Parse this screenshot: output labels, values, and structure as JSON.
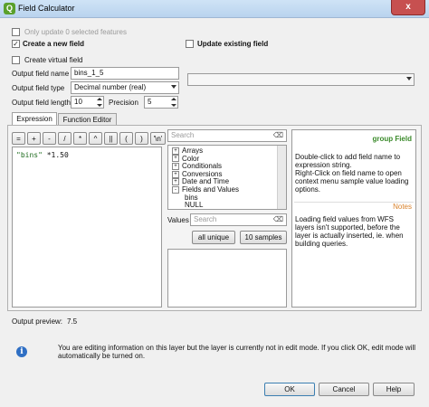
{
  "window": {
    "title": "Field Calculator",
    "close_glyph": "x",
    "app_icon_letter": "Q"
  },
  "options": {
    "only_update_selected": "Only update 0 selected features",
    "create_new_field": "Create a new field",
    "update_existing_field": "Update existing field",
    "create_virtual_field": "Create virtual field"
  },
  "fields": {
    "output_field_name_label": "Output field name",
    "output_field_name_value": "bins_1_5",
    "output_field_type_label": "Output field type",
    "output_field_type_value": "Decimal number (real)",
    "output_field_length_label": "Output field length",
    "output_field_length_value": "10",
    "precision_label": "Precision",
    "precision_value": "5"
  },
  "tabs": [
    {
      "label": "Expression"
    },
    {
      "label": "Function Editor"
    }
  ],
  "operators": [
    "=",
    "+",
    "-",
    "/",
    "*",
    "^",
    "||",
    "(",
    ")",
    "'\\n'"
  ],
  "expression": {
    "field": "\"bins\"",
    "rest": " *1.50"
  },
  "functions": {
    "search_placeholder": "Search",
    "items": [
      {
        "label": "Arrays",
        "sign": "+"
      },
      {
        "label": "Color",
        "sign": "+"
      },
      {
        "label": "Conditionals",
        "sign": "+"
      },
      {
        "label": "Conversions",
        "sign": "+"
      },
      {
        "label": "Date and Time",
        "sign": "+"
      },
      {
        "label": "Fields and Values",
        "sign": "-"
      },
      {
        "label": "bins",
        "sign": ""
      },
      {
        "label": "NULL",
        "sign": ""
      }
    ]
  },
  "values": {
    "label": "Values",
    "search_placeholder": "Search",
    "all_unique_button": "all unique",
    "samples_button": "10 samples"
  },
  "help": {
    "group_title": "group Field",
    "group_text": "Double-click to add field name to expression string.\nRight-Click on field name to open context menu sample value loading options.",
    "notes_title": "Notes",
    "notes_text": "Loading field values from WFS layers isn't supported, before the layer is actually inserted, ie. when building queries."
  },
  "preview": {
    "label": "Output preview:",
    "value": "7.5"
  },
  "info": {
    "message": "You are editing information on this layer but the layer is currently not in edit mode. If you click OK, edit mode will automatically be turned on."
  },
  "buttons": {
    "ok": "OK",
    "cancel": "Cancel",
    "help": "Help"
  },
  "colors": {
    "titlebar": "#c4dcf3",
    "help_title": "#3a8a2a",
    "notes_title": "#d9822b",
    "info_icon": "#2f6fc4",
    "close_button": "#c75050"
  }
}
